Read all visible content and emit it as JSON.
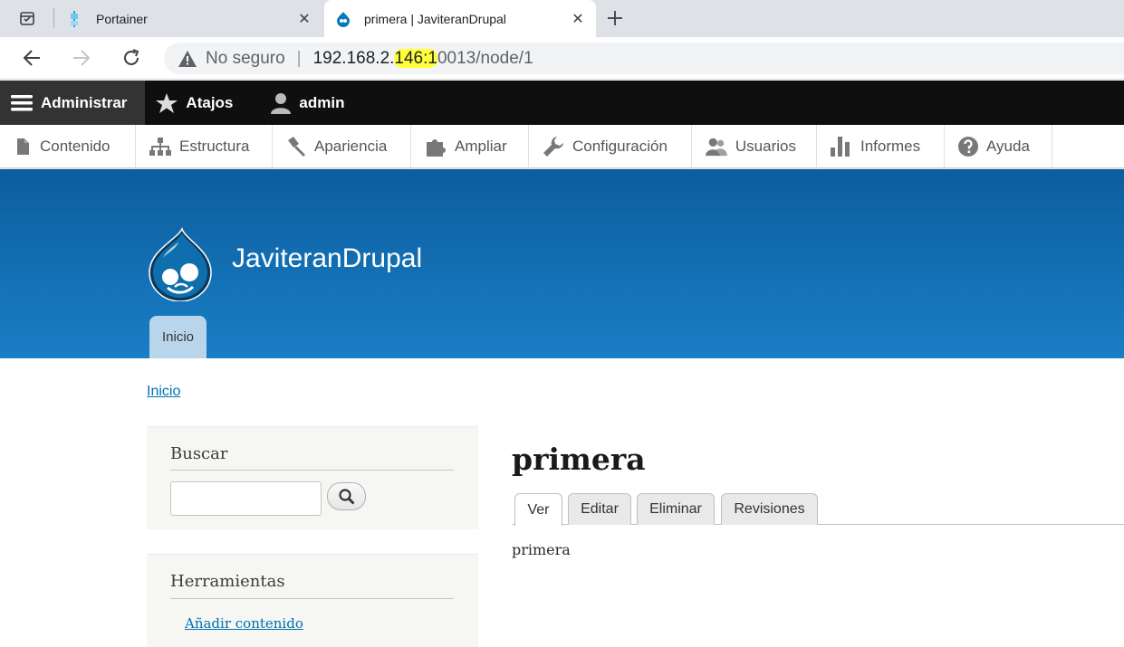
{
  "browser": {
    "tabs": [
      {
        "title": "Portainer",
        "active": false
      },
      {
        "title": "primera | JaviteranDrupal",
        "active": true
      }
    ],
    "close_glyph": "✕",
    "new_tab_glyph": "+",
    "omnibox": {
      "security_label": "No seguro",
      "separator": "|",
      "host_before_highlight": "192.168.2.",
      "host_highlight": "146:1",
      "host_after_highlight": "0013",
      "path": "/node/1"
    }
  },
  "admin_toolbar": {
    "items": [
      {
        "label": "Administrar",
        "icon": "hamburger-icon"
      },
      {
        "label": "Atajos",
        "icon": "star-icon"
      },
      {
        "label": "admin",
        "icon": "user-icon"
      }
    ]
  },
  "admin_tray": {
    "items": [
      {
        "label": "Contenido",
        "icon": "document-icon"
      },
      {
        "label": "Estructura",
        "icon": "sitemap-icon"
      },
      {
        "label": "Apariencia",
        "icon": "paintbrush-icon"
      },
      {
        "label": "Ampliar",
        "icon": "puzzle-icon"
      },
      {
        "label": "Configuración",
        "icon": "wrench-icon"
      },
      {
        "label": "Usuarios",
        "icon": "people-icon"
      },
      {
        "label": "Informes",
        "icon": "bar-chart-icon"
      },
      {
        "label": "Ayuda",
        "icon": "help-icon"
      }
    ]
  },
  "site": {
    "name": "JaviteranDrupal",
    "primary_tab": "Inicio",
    "header_color_top": "#0b5e9e",
    "header_color_bottom": "#1a7ec5"
  },
  "breadcrumb": "Inicio",
  "sidebar": {
    "search": {
      "title": "Buscar",
      "input_value": ""
    },
    "tools": {
      "title": "Herramientas",
      "link": "Añadir contenido"
    }
  },
  "node": {
    "title": "primera",
    "tabs": [
      "Ver",
      "Editar",
      "Eliminar",
      "Revisiones"
    ],
    "active_tab": "Ver",
    "body": "primera"
  },
  "colors": {
    "link": "#0071b3",
    "highlight": "#ffff3a",
    "admin_bar": "#0f0f0f"
  }
}
